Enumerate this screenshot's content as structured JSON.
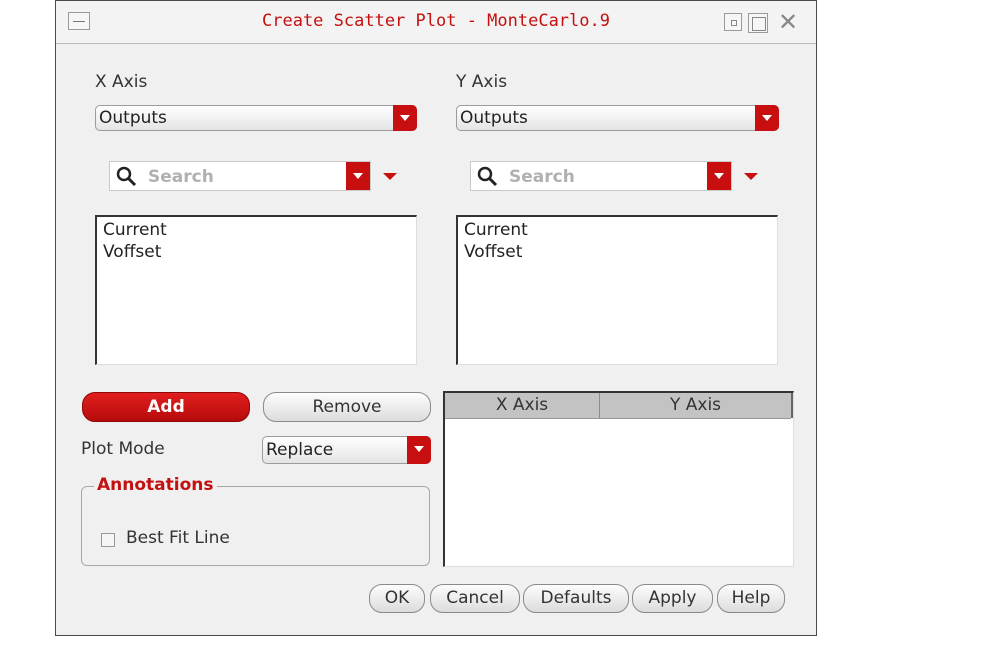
{
  "window": {
    "title": "Create Scatter Plot - MonteCarlo.9"
  },
  "x_axis": {
    "label": "X Axis",
    "selected": "Outputs",
    "search_placeholder": "Search",
    "items": [
      "Current",
      "Voffset"
    ]
  },
  "y_axis": {
    "label": "Y Axis",
    "selected": "Outputs",
    "search_placeholder": "Search",
    "items": [
      "Current",
      "Voffset"
    ]
  },
  "buttons": {
    "add": "Add",
    "remove": "Remove"
  },
  "plot_mode": {
    "label": "Plot Mode",
    "selected": "Replace"
  },
  "annotations": {
    "title": "Annotations",
    "best_fit_label": "Best Fit Line",
    "best_fit_checked": false
  },
  "pairs_table": {
    "columns": [
      "X Axis",
      "Y Axis"
    ],
    "rows": []
  },
  "footer": {
    "ok": "OK",
    "cancel": "Cancel",
    "defaults": "Defaults",
    "apply": "Apply",
    "help": "Help"
  },
  "colors": {
    "accent": "#c80f0f",
    "title_text": "#c41010"
  }
}
